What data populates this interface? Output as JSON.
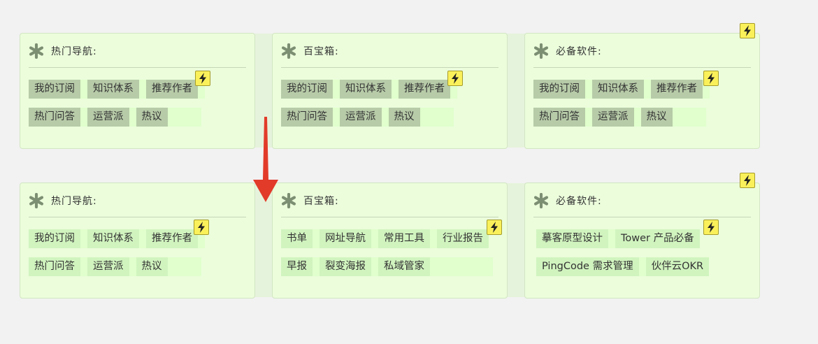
{
  "colors": {
    "card_bg": "#ebfddb",
    "gray_tag": "#b7cba8",
    "light_tag": "#d1f4bf",
    "bolt": "#faf05a",
    "arrow": "#e23b2a"
  },
  "before": {
    "cards": [
      {
        "title": "热门导航:",
        "rows": [
          [
            "我的订阅",
            "知识体系",
            "推荐作者"
          ],
          [
            "热门问答",
            "运营派",
            "热议"
          ]
        ]
      },
      {
        "title": "百宝箱:",
        "rows": [
          [
            "我的订阅",
            "知识体系",
            "推荐作者"
          ],
          [
            "热门问答",
            "运营派",
            "热议"
          ]
        ]
      },
      {
        "title": "必备软件:",
        "rows": [
          [
            "我的订阅",
            "知识体系",
            "推荐作者"
          ],
          [
            "热门问答",
            "运营派",
            "热议"
          ]
        ]
      }
    ]
  },
  "after": {
    "cards": [
      {
        "title": "热门导航:",
        "rows": [
          [
            "我的订阅",
            "知识体系",
            "推荐作者"
          ],
          [
            "热门问答",
            "运营派",
            "热议"
          ]
        ]
      },
      {
        "title": "百宝箱:",
        "rows": [
          [
            "书单",
            "网址导航",
            "常用工具",
            "行业报告"
          ],
          [
            "早报",
            "裂变海报",
            "私域管家"
          ]
        ]
      },
      {
        "title": "必备软件:",
        "rows": [
          [
            "摹客原型设计",
            "Tower 产品必备"
          ],
          [
            "PingCode 需求管理",
            "伙伴云OKR"
          ]
        ]
      }
    ]
  },
  "icons": {
    "card_icon": "asterisk-icon",
    "badge_icon": "lightning-bolt-icon",
    "transition": "arrow-down-icon"
  }
}
